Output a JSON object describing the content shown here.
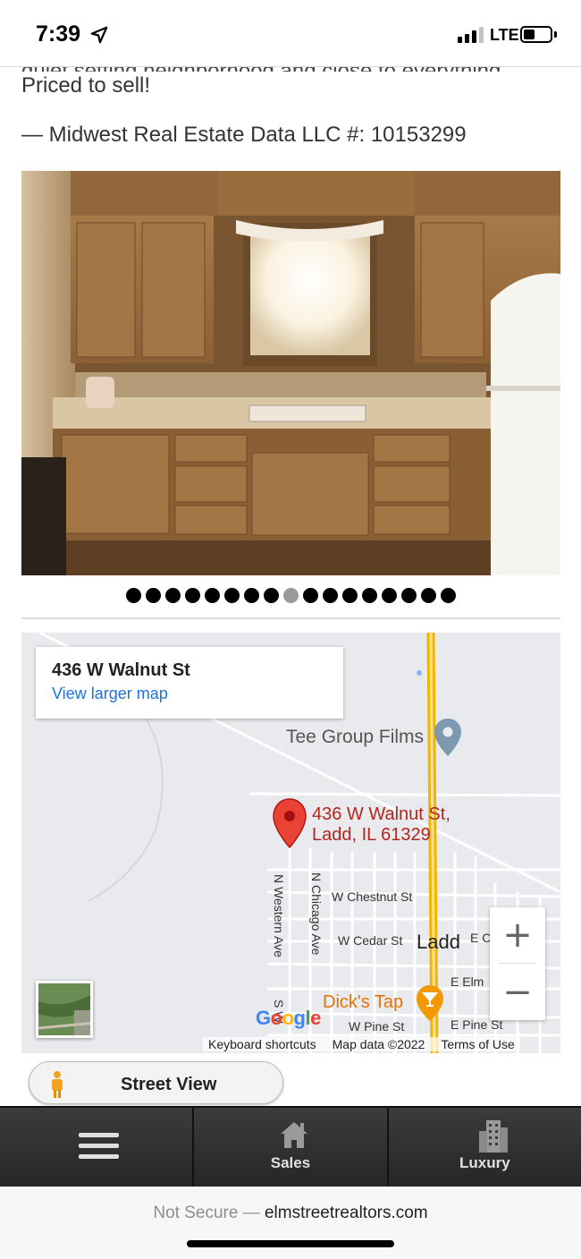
{
  "status_bar": {
    "time": "7:39",
    "network": "LTE",
    "icons": [
      "location-arrow-icon",
      "signal-icon",
      "battery-icon"
    ]
  },
  "listing": {
    "partial_text": "quiet setting neighborhood and close to everything",
    "priced_text": "Priced to sell!",
    "mls_text": "— Midwest Real Estate Data LLC #: 10153299"
  },
  "gallery": {
    "total_photos": 17,
    "active_index": 8
  },
  "map": {
    "card_title": "436 W Walnut St",
    "card_link": "View larger map",
    "poi_tee": "Tee Group Films",
    "pin_line1": "436 W Walnut St,",
    "pin_line2": "Ladd, IL 61329",
    "street_chestnut": "W Chestnut St",
    "street_cedar": "W Cedar St",
    "town": "Ladd",
    "street_ec": "E C",
    "street_elm": "E Elm",
    "poi_dicks": "Dick's Tap",
    "street_wpine": "W Pine St",
    "street_epine": "E Pine St",
    "street_nwestern": "N Western Ave",
    "street_nchicago": "N Chicago Ave",
    "street_s": "S W",
    "zoom_in": "+",
    "zoom_out": "−",
    "footer_keyboard": "Keyboard shortcuts",
    "footer_data": "Map data ©2022",
    "footer_terms": "Terms of Use",
    "google": "Google"
  },
  "street_view": {
    "label": "Street View"
  },
  "bottom_nav": {
    "items": [
      {
        "label": "",
        "icon": "menu-icon"
      },
      {
        "label": "Sales",
        "icon": "house-icon"
      },
      {
        "label": "Luxury",
        "icon": "building-icon"
      }
    ]
  },
  "browser": {
    "insecure_label": "Not Secure —",
    "domain": "elmstreetrealtors.com"
  }
}
